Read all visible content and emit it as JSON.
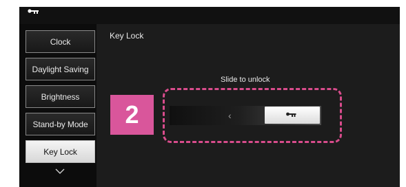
{
  "header": {
    "icon": "key-icon"
  },
  "sidebar": {
    "items": [
      {
        "label": "Clock",
        "active": false
      },
      {
        "label": "Daylight Saving",
        "active": false
      },
      {
        "label": "Brightness",
        "active": false
      },
      {
        "label": "Stand-by Mode",
        "active": false
      },
      {
        "label": "Key Lock",
        "active": true
      }
    ],
    "scroll_icon": "chevron-down-icon"
  },
  "main": {
    "title": "Key Lock",
    "slider": {
      "label": "Slide to unlock",
      "arrow_glyph": "‹",
      "handle_icon": "key-icon"
    }
  },
  "annotation": {
    "step_number": "2",
    "color": "#d9569b"
  }
}
